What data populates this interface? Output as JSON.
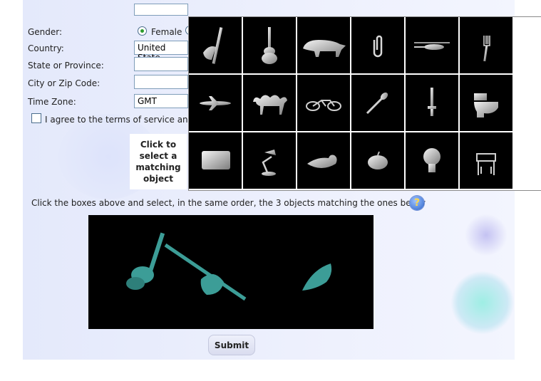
{
  "form": {
    "gender_label": "Gender:",
    "gender_female": "Female",
    "country_label": "Country:",
    "country_value": "United State",
    "state_label": "State or Province:",
    "state_value": "",
    "city_label": "City or Zip Code:",
    "city_value": "",
    "timezone_label": "Time Zone:",
    "timezone_value": "GMT",
    "terms_label": "I agree to the terms of service and"
  },
  "captcha": {
    "click_prompt": "Click to select a matching object",
    "instruction": "Click the boxes above and select, in the same order, the 3 objects matching the ones below",
    "help_icon_glyph": "?",
    "grid": [
      [
        "axe-pen-icon",
        "guitar-icon",
        "rhino-icon",
        "paperclip-icon",
        "helicopter-icon",
        "fork-icon"
      ],
      [
        "airplane-icon",
        "camel-icon",
        "bicycle-icon",
        "spoon-icon",
        "sword-icon",
        "toilet-icon"
      ],
      [
        "mug-icon",
        "desk-lamp-icon",
        "duck-icon",
        "apple-icon",
        "lightbulb-icon",
        "chair-icon"
      ]
    ],
    "target_colors": {
      "shape": "#3c9d97",
      "background": "#000000"
    }
  },
  "submit_label": "Submit"
}
